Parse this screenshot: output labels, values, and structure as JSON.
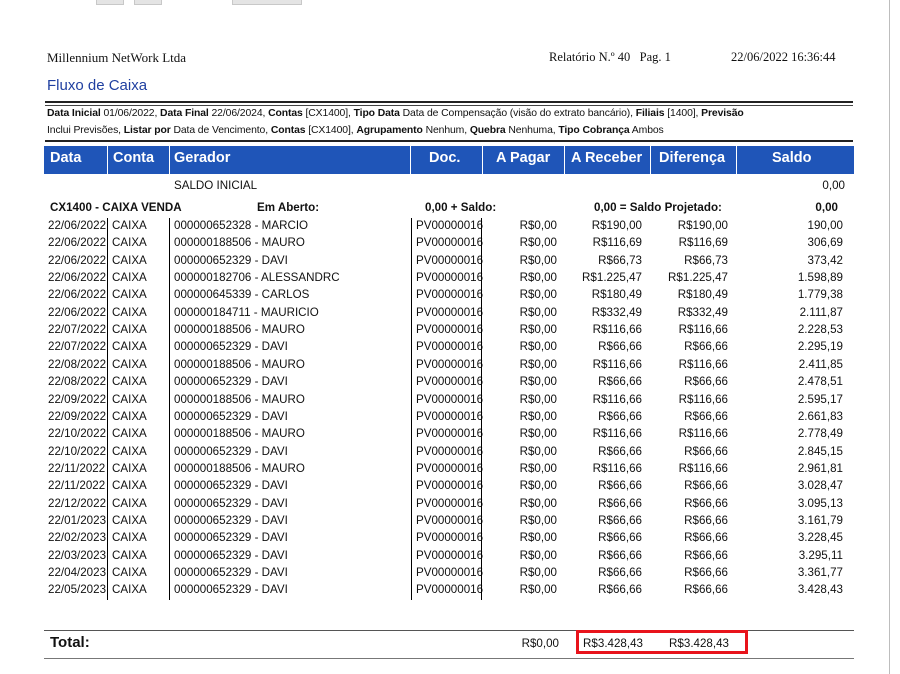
{
  "company": "Millennium NetWork Ltda",
  "report_number": "Relatório N.º 40",
  "page_label": "Pag. 1",
  "datetime": "22/06/2022 16:36:44",
  "title": "Fluxo de Caixa",
  "filters": {
    "line1": [
      {
        "k": "Data Inicial",
        "v": " 01/06/2022, "
      },
      {
        "k": "Data Final",
        "v": " 22/06/2024, "
      },
      {
        "k": "Contas",
        "v": " [CX1400], "
      },
      {
        "k": "Tipo Data",
        "v": " Data de Compensação (visão do extrato bancário), "
      },
      {
        "k": "Filiais",
        "v": " [1400], "
      },
      {
        "k": "Previsão",
        "v": ""
      }
    ],
    "line2": [
      {
        "k": "",
        "v": "Inclui Previsões, "
      },
      {
        "k": "Listar por",
        "v": " Data de Vencimento, "
      },
      {
        "k": "Contas",
        "v": " [CX1400], "
      },
      {
        "k": "Agrupamento",
        "v": " Nenhum, "
      },
      {
        "k": "Quebra",
        "v": " Nenhuma, "
      },
      {
        "k": "Tipo Cobrança",
        "v": " Ambos"
      }
    ]
  },
  "columns": [
    "Data",
    "Conta",
    "Gerador",
    "Doc.",
    "A Pagar",
    "A Receber",
    "Diferença",
    "Saldo"
  ],
  "saldo_inicial": {
    "label": "SALDO INICIAL",
    "value": "0,00"
  },
  "account_summary": {
    "account": "CX1400 - CAIXA VENDA",
    "em_aberto_label": "Em Aberto:",
    "em_aberto_value": "0,00 + Saldo:",
    "saldo_value": "0,00 = Saldo Projetado:",
    "projetado_value": "0,00"
  },
  "rows": [
    [
      "22/06/2022",
      "CAIXA",
      "000000652328 - MARCIO",
      "PV00000016",
      "R$0,00",
      "R$190,00",
      "R$190,00",
      "190,00"
    ],
    [
      "22/06/2022",
      "CAIXA",
      "000000188506 - MAURO",
      "PV00000016",
      "R$0,00",
      "R$116,69",
      "R$116,69",
      "306,69"
    ],
    [
      "22/06/2022",
      "CAIXA",
      "000000652329 - DAVI",
      "PV00000016",
      "R$0,00",
      "R$66,73",
      "R$66,73",
      "373,42"
    ],
    [
      "22/06/2022",
      "CAIXA",
      "000000182706 - ALESSANDRC",
      "PV00000016",
      "R$0,00",
      "R$1.225,47",
      "R$1.225,47",
      "1.598,89"
    ],
    [
      "22/06/2022",
      "CAIXA",
      "000000645339 - CARLOS",
      "PV00000016",
      "R$0,00",
      "R$180,49",
      "R$180,49",
      "1.779,38"
    ],
    [
      "22/06/2022",
      "CAIXA",
      "000000184711 - MAURICIO",
      "PV00000016",
      "R$0,00",
      "R$332,49",
      "R$332,49",
      "2.111,87"
    ],
    [
      "22/07/2022",
      "CAIXA",
      "000000188506 - MAURO",
      "PV00000016",
      "R$0,00",
      "R$116,66",
      "R$116,66",
      "2.228,53"
    ],
    [
      "22/07/2022",
      "CAIXA",
      "000000652329 - DAVI",
      "PV00000016",
      "R$0,00",
      "R$66,66",
      "R$66,66",
      "2.295,19"
    ],
    [
      "22/08/2022",
      "CAIXA",
      "000000188506 - MAURO",
      "PV00000016",
      "R$0,00",
      "R$116,66",
      "R$116,66",
      "2.411,85"
    ],
    [
      "22/08/2022",
      "CAIXA",
      "000000652329 - DAVI",
      "PV00000016",
      "R$0,00",
      "R$66,66",
      "R$66,66",
      "2.478,51"
    ],
    [
      "22/09/2022",
      "CAIXA",
      "000000188506 - MAURO",
      "PV00000016",
      "R$0,00",
      "R$116,66",
      "R$116,66",
      "2.595,17"
    ],
    [
      "22/09/2022",
      "CAIXA",
      "000000652329 - DAVI",
      "PV00000016",
      "R$0,00",
      "R$66,66",
      "R$66,66",
      "2.661,83"
    ],
    [
      "22/10/2022",
      "CAIXA",
      "000000188506 - MAURO",
      "PV00000016",
      "R$0,00",
      "R$116,66",
      "R$116,66",
      "2.778,49"
    ],
    [
      "22/10/2022",
      "CAIXA",
      "000000652329 - DAVI",
      "PV00000016",
      "R$0,00",
      "R$66,66",
      "R$66,66",
      "2.845,15"
    ],
    [
      "22/11/2022",
      "CAIXA",
      "000000188506 - MAURO",
      "PV00000016",
      "R$0,00",
      "R$116,66",
      "R$116,66",
      "2.961,81"
    ],
    [
      "22/11/2022",
      "CAIXA",
      "000000652329 - DAVI",
      "PV00000016",
      "R$0,00",
      "R$66,66",
      "R$66,66",
      "3.028,47"
    ],
    [
      "22/12/2022",
      "CAIXA",
      "000000652329 - DAVI",
      "PV00000016",
      "R$0,00",
      "R$66,66",
      "R$66,66",
      "3.095,13"
    ],
    [
      "22/01/2023",
      "CAIXA",
      "000000652329 - DAVI",
      "PV00000016",
      "R$0,00",
      "R$66,66",
      "R$66,66",
      "3.161,79"
    ],
    [
      "22/02/2023",
      "CAIXA",
      "000000652329 - DAVI",
      "PV00000016",
      "R$0,00",
      "R$66,66",
      "R$66,66",
      "3.228,45"
    ],
    [
      "22/03/2023",
      "CAIXA",
      "000000652329 - DAVI",
      "PV00000016",
      "R$0,00",
      "R$66,66",
      "R$66,66",
      "3.295,11"
    ],
    [
      "22/04/2023",
      "CAIXA",
      "000000652329 - DAVI",
      "PV00000016",
      "R$0,00",
      "R$66,66",
      "R$66,66",
      "3.361,77"
    ],
    [
      "22/05/2023",
      "CAIXA",
      "000000652329 - DAVI",
      "PV00000016",
      "R$0,00",
      "R$66,66",
      "R$66,66",
      "3.428,43"
    ]
  ],
  "total": {
    "label": "Total:",
    "a_pagar": "R$0,00",
    "a_receber": "R$3.428,43",
    "diferenca": "R$3.428,43"
  },
  "colors": {
    "header_bg": "#1f55b8",
    "title": "#1f3fa0",
    "highlight": "#e8131b"
  }
}
